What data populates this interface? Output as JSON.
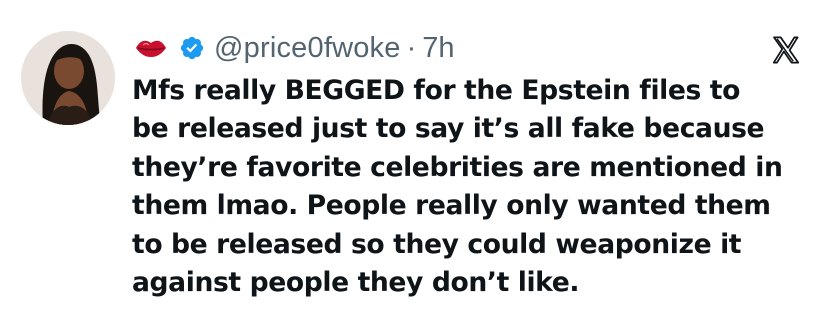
{
  "tweet": {
    "author": {
      "handle": "@price0fwoke",
      "time": "7h",
      "separator": "·",
      "verified": true,
      "name_icon": "kiss-mark-lips-icon"
    },
    "text_lines": [
      "Mfs really BEGGED for the Epstein files to",
      "be released just to say it’s all fake because",
      "they’re favorite celebrities are mentioned in",
      "them lmao. People really only wanted them",
      "to be released so they could weaponize it",
      "against people they don’t like."
    ],
    "platform_logo": "x-logo-icon",
    "colors": {
      "verified_badge": "#1d9bf0",
      "secondary_text": "#536471",
      "primary_text": "#0f1419",
      "lips": "#c8102e"
    }
  }
}
